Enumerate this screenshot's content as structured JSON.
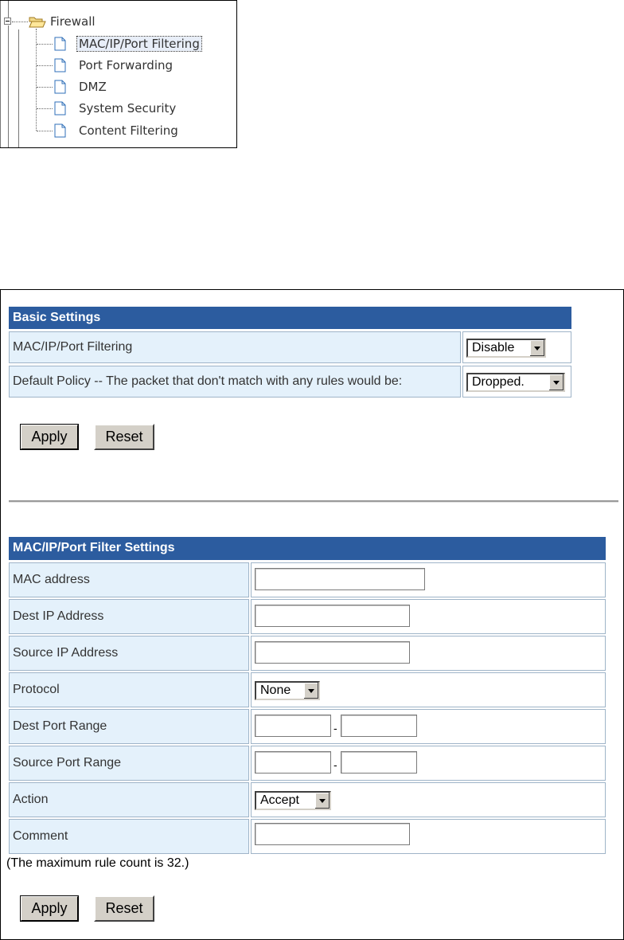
{
  "tree": {
    "folder_label": "Firewall",
    "items": [
      {
        "label": "MAC/IP/Port Filtering",
        "selected": true
      },
      {
        "label": "Port Forwarding",
        "selected": false
      },
      {
        "label": "DMZ",
        "selected": false
      },
      {
        "label": "System Security",
        "selected": false
      },
      {
        "label": "Content Filtering",
        "selected": false
      }
    ]
  },
  "basic": {
    "header": "Basic Settings",
    "filtering_label": "MAC/IP/Port Filtering",
    "filtering_value": "Disable",
    "policy_label": "Default Policy -- The packet that don't match with any rules would be:",
    "policy_value": "Dropped.",
    "apply_label": "Apply",
    "reset_label": "Reset"
  },
  "filter": {
    "header": "MAC/IP/Port Filter Settings",
    "mac_label": "MAC address",
    "mac_value": "",
    "dest_ip_label": "Dest IP Address",
    "dest_ip_value": "",
    "source_ip_label": "Source IP Address",
    "source_ip_value": "",
    "protocol_label": "Protocol",
    "protocol_value": "None",
    "dest_port_label": "Dest Port Range",
    "source_port_label": "Source Port Range",
    "range_separator": "-",
    "action_label": "Action",
    "action_value": "Accept",
    "comment_label": "Comment",
    "comment_value": "",
    "note": "(The maximum rule count is 32.)",
    "apply_label": "Apply",
    "reset_label": "Reset"
  },
  "colors": {
    "header_bg": "#2c5c9f",
    "label_cell_bg": "#e4f1fb",
    "button_face": "#d4d0c8"
  }
}
